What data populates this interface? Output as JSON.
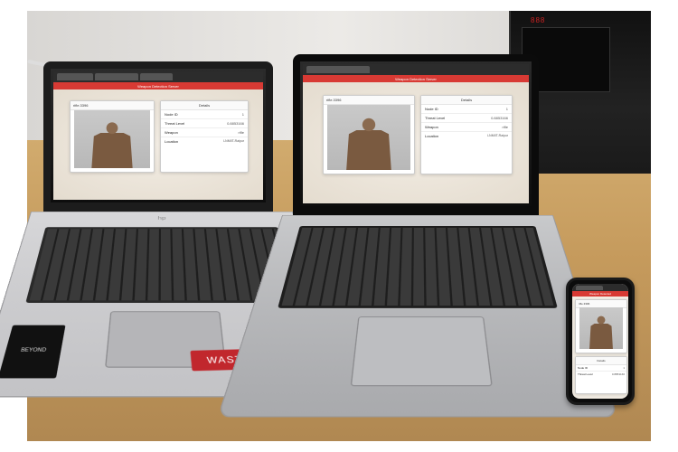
{
  "app": {
    "header": "Weapon Detection Server",
    "image_panel_title": "rifle.3396",
    "details_title": "Details",
    "fields": {
      "node_id_label": "Node ID",
      "node_id_value": "1",
      "threat_label": "Threat Level",
      "threat_value": "0.8853166",
      "weapon_label": "Weapon",
      "weapon_value": "rifle",
      "location_label": "Location",
      "location_value": "LNMIIT-Raipur"
    }
  },
  "oscilloscope": {
    "readout": "888"
  },
  "laptop_left": {
    "brand": "hp",
    "stickers": {
      "beyond": "BEYOND",
      "wasted": "WASTED"
    }
  },
  "phone": {
    "header": "Weapon Detected"
  }
}
